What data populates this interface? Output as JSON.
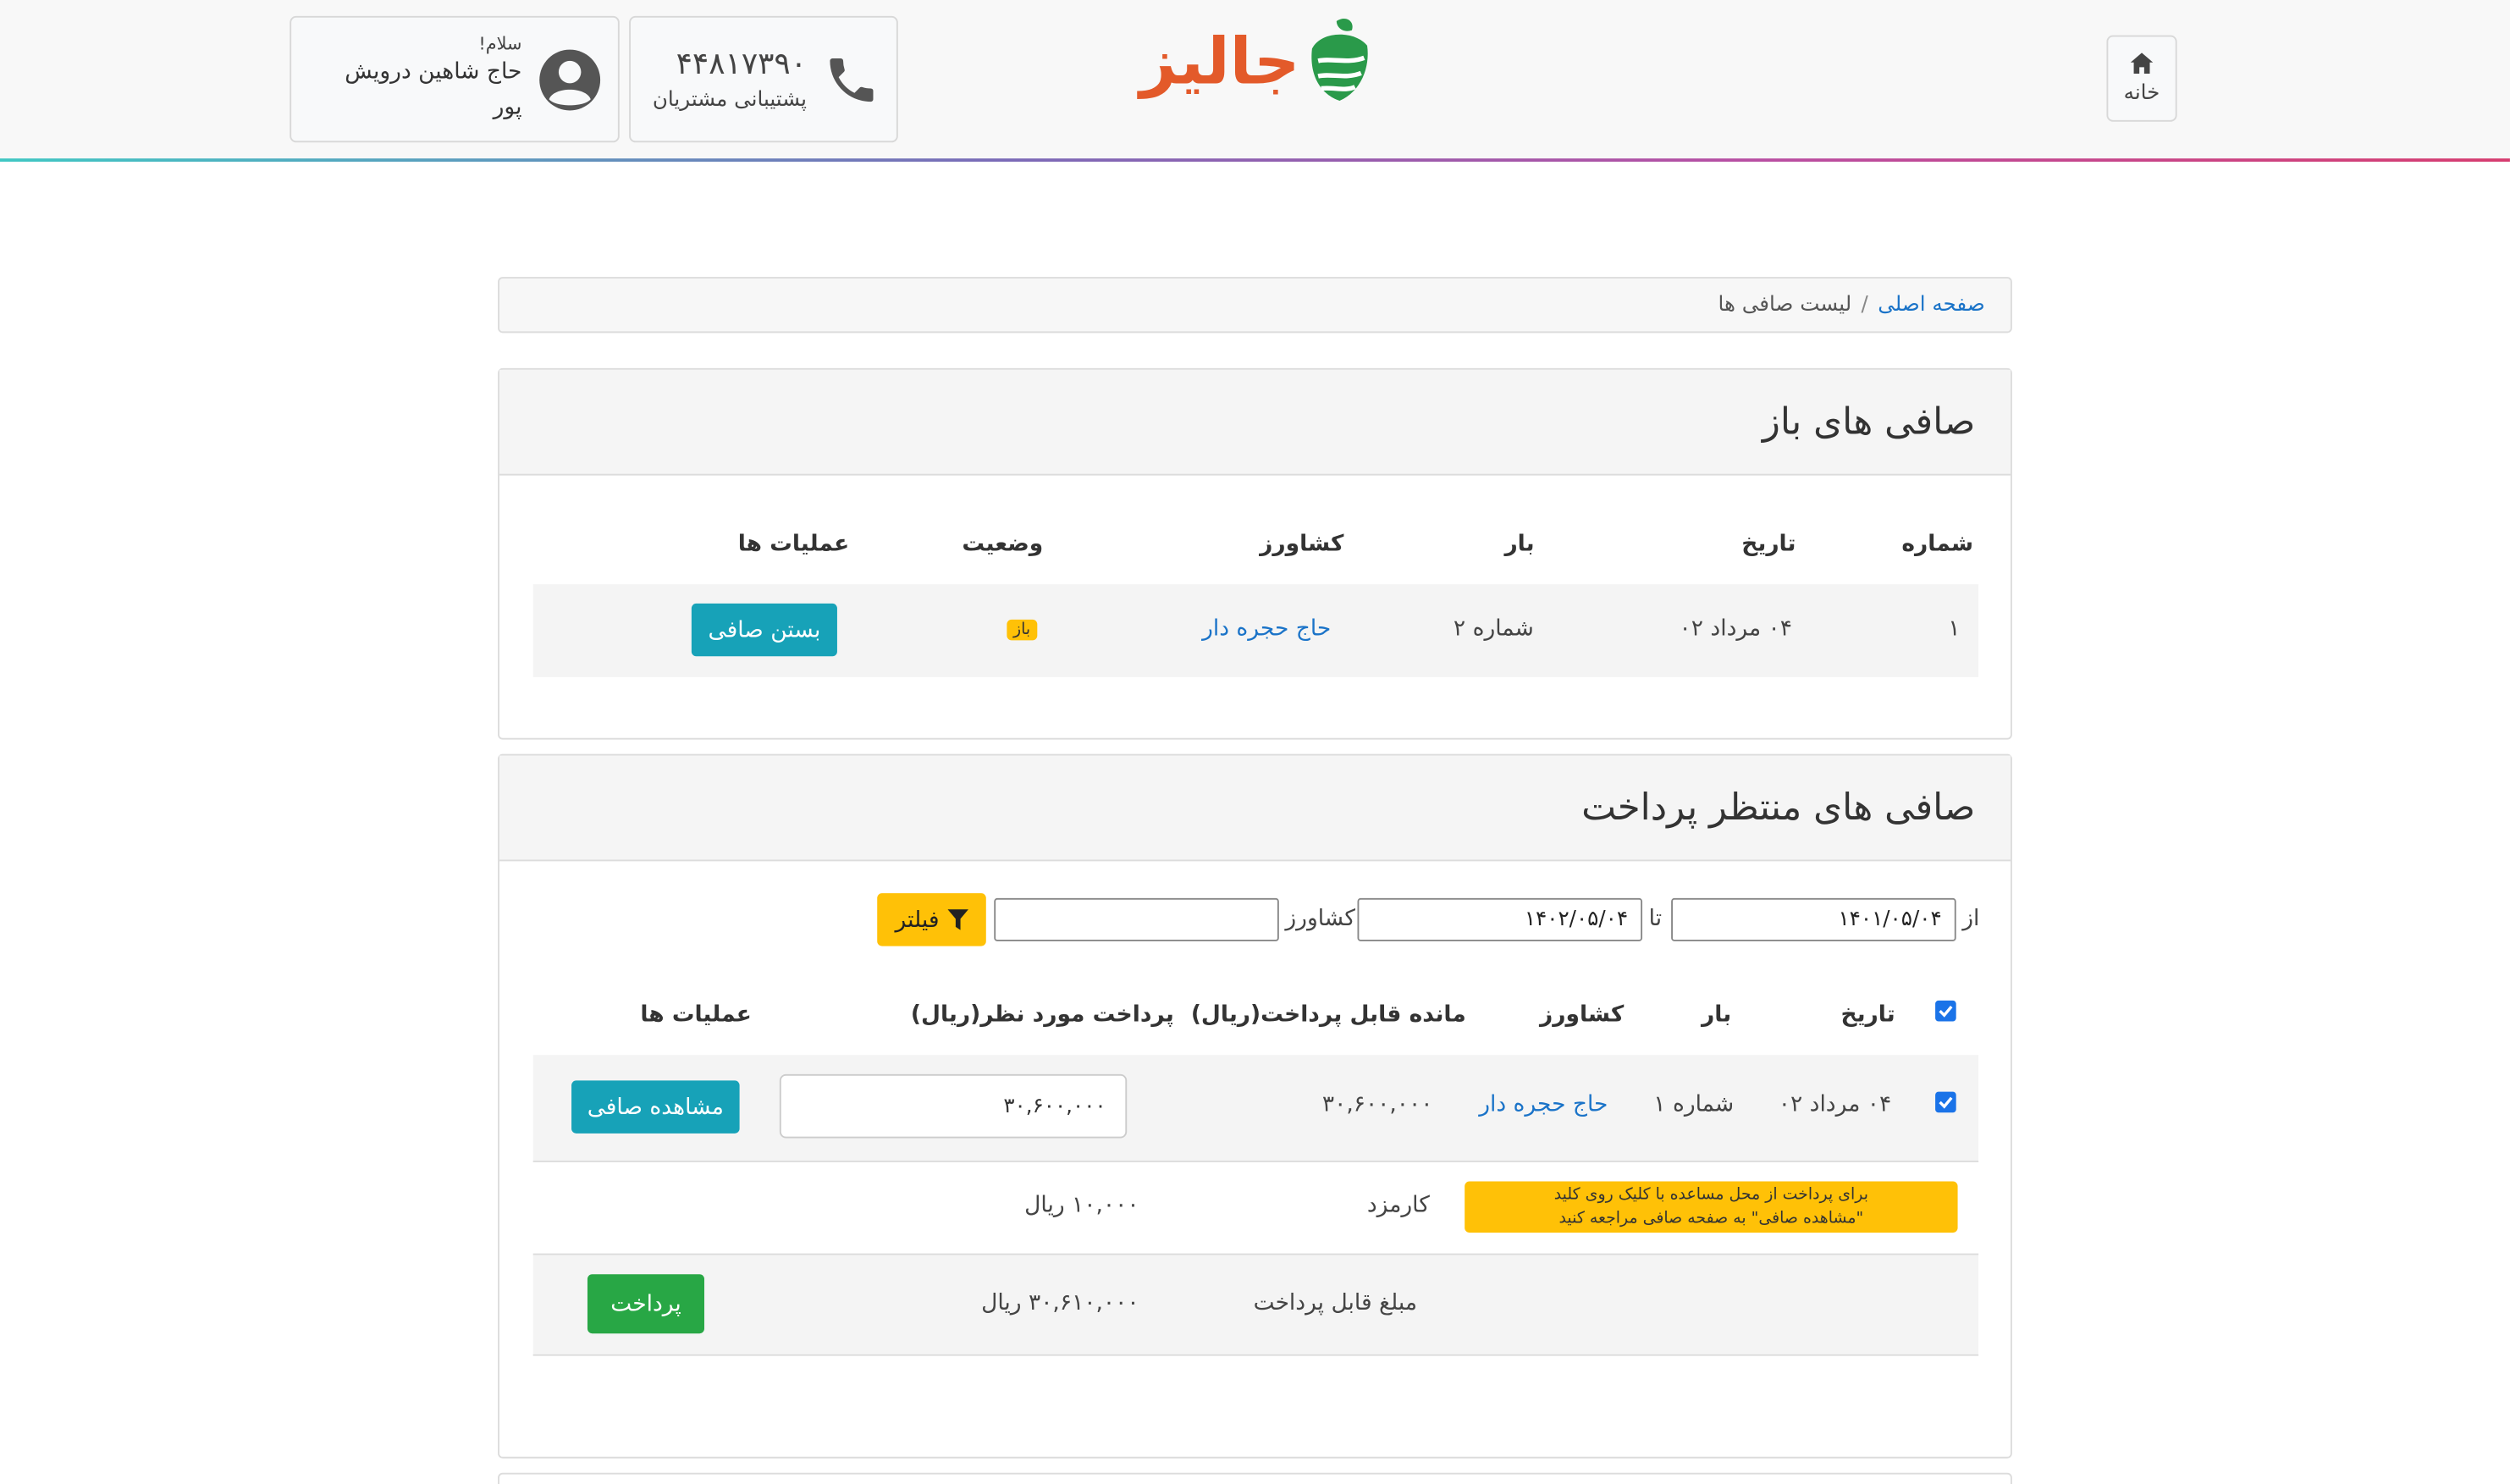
{
  "header": {
    "home_label": "خانه",
    "logo_text": "جالیز",
    "support_phone": "۴۴۸۱۷۳۹۰",
    "support_label": "پشتیبانی مشتریان",
    "user_greeting": "سلام!",
    "user_name": "حاج شاهین درویش پور",
    "accent_colors": [
      "#3fc7c3",
      "#b84ea2",
      "#d63c6f"
    ]
  },
  "breadcrumb": {
    "home": "صفحه اصلی",
    "separator": "/",
    "current": "لیست صافی ها"
  },
  "open_card": {
    "title": "صافی های باز",
    "columns": {
      "number": "شماره",
      "date": "تاریخ",
      "load": "بار",
      "farmer": "کشاورز",
      "status": "وضعیت",
      "actions": "عملیات ها"
    },
    "rows": [
      {
        "number": "۱",
        "date": "۰۴ مرداد ۰۲",
        "load": "شماره ۲",
        "farmer": "حاج حجره دار",
        "status": "باز",
        "action": "بستن صافی"
      }
    ]
  },
  "pending_card": {
    "title": "صافی های منتظر پرداخت",
    "filter": {
      "from_label": "از",
      "from_value": "۱۴۰۱/۰۵/۰۴",
      "to_label": "تا",
      "to_value": "۱۴۰۲/۰۵/۰۴",
      "farmer_label": "کشاورز",
      "farmer_value": "",
      "button": "فیلتر"
    },
    "columns": {
      "date": "تاریخ",
      "load": "بار",
      "farmer": "کشاورز",
      "remaining": "مانده قابل پرداخت(ریال)",
      "payment": "پرداخت مورد نظر(ریال)",
      "actions": "عملیات ها"
    },
    "rows": [
      {
        "checked": true,
        "date": "۰۴ مرداد ۰۲",
        "load": "شماره ۱",
        "farmer": "حاج حجره دار",
        "remaining": "۳۰,۶۰۰,۰۰۰",
        "payment": "۳۰,۶۰۰,۰۰۰",
        "action": "مشاهده صافی"
      }
    ],
    "note_line1": "برای پرداخت از محل مساعده با کلیک روی کلید",
    "note_line2": "\"مشاهده صافی\" به صفحه صافی مراجعه کنید",
    "fee_label": "کارمزد",
    "fee_value": "۱۰,۰۰۰ ریال",
    "total_label": "مبلغ قابل پرداخت",
    "total_value": "۳۰,۶۱۰,۰۰۰ ریال",
    "pay_button": "پرداخت"
  }
}
